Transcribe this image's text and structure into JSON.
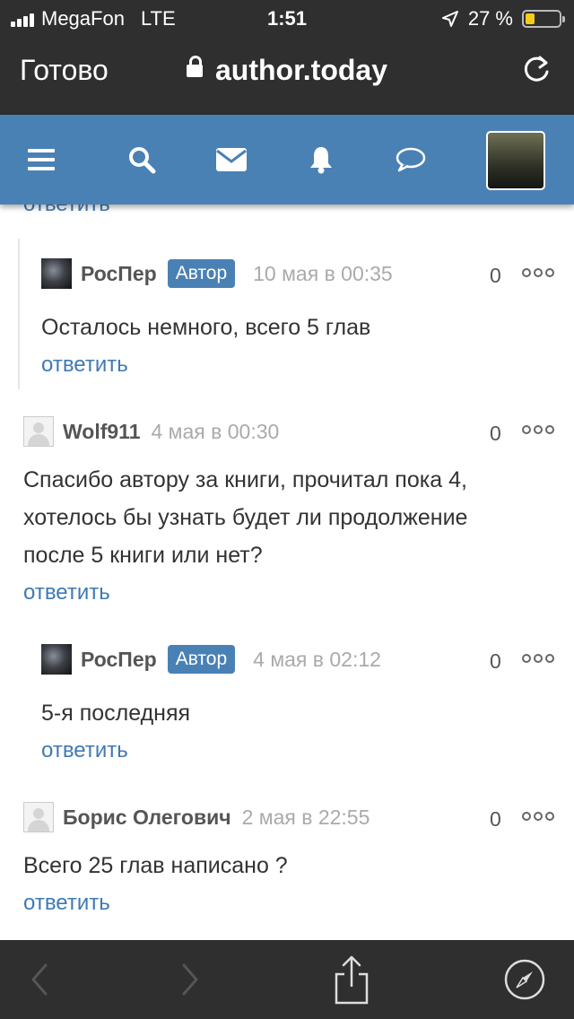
{
  "status": {
    "carrier": "MegaFon",
    "network": "LTE",
    "time": "1:51",
    "battery_text": "27 %",
    "battery_color": "#f5cc1b"
  },
  "browser": {
    "done_label": "Готово",
    "url": "author.today"
  },
  "nav": {
    "icons": [
      "menu-icon",
      "search-icon",
      "mail-icon",
      "bell-icon",
      "chat-icon"
    ],
    "bg_color": "#4a81b4"
  },
  "reply_label": "ответить",
  "comments": [
    {
      "author": "РосПер",
      "badge": "Автор",
      "date": "10 мая в 00:35",
      "count": "0",
      "text": "Осталось немного, всего 5 глав"
    },
    {
      "author": "Wolf911",
      "date": "4 мая в 00:30",
      "count": "0",
      "lines": [
        "Спасибо автору за книги, прочитал пока 4,",
        "хотелось бы узнать будет ли продолжение",
        "после 5 книги или нет?"
      ]
    },
    {
      "author": "РосПер",
      "badge": "Автор",
      "date": "4 мая в 02:12",
      "count": "0",
      "text": "5-я последняя"
    },
    {
      "author": "Борис Олегович",
      "date": "2 мая в 22:55",
      "count": "0",
      "text": "Всего 25 глав написано ?"
    }
  ],
  "toolbar": {
    "icons": [
      "back-icon",
      "forward-icon",
      "share-icon",
      "compass-icon"
    ]
  }
}
